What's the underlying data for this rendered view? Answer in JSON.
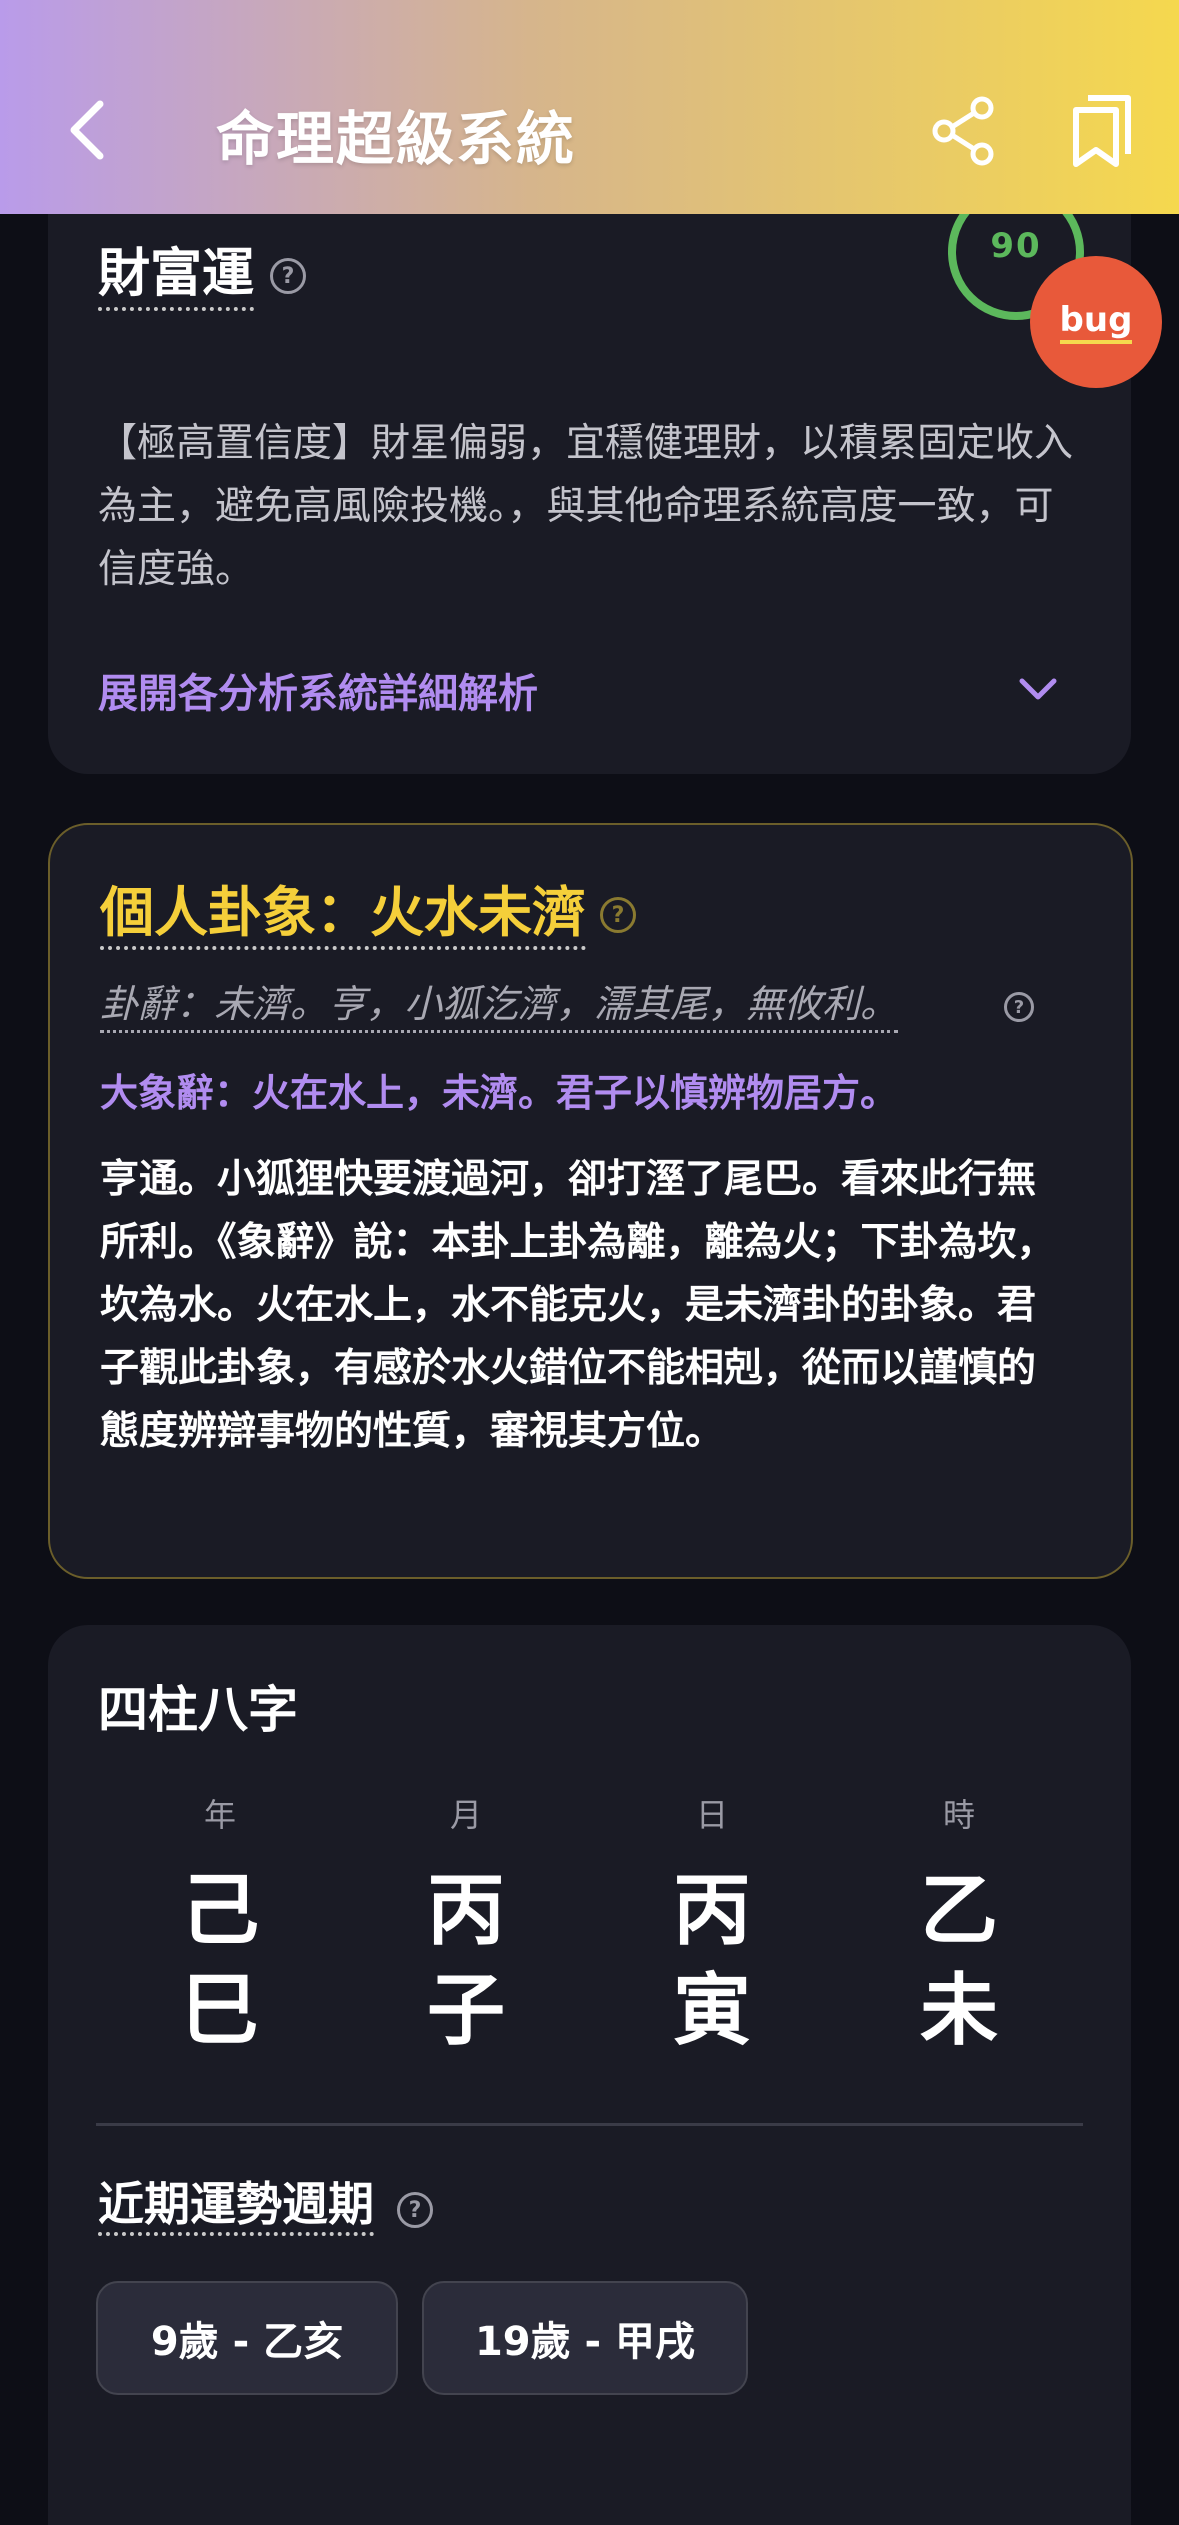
{
  "header": {
    "title": "命理超級系統",
    "back_icon": "chevron-left-icon",
    "share_icon": "share-icon",
    "bookmark_icon": "bookmark-icon",
    "gradient_start": "#b99bea",
    "gradient_end": "#f5d84e"
  },
  "wealth": {
    "title": "財富運",
    "score": "90",
    "score_progress": 0.9,
    "score_color": "#5cb85c",
    "body": "【極高置信度】財星偏弱，宜穩健理財，以積累固定收入為主，避免高風險投機。，與其他命理系統高度一致，可信度強。",
    "expand_label": "展開各分析系統詳細解析"
  },
  "bug_button": {
    "label": "bug",
    "color": "#e8593a"
  },
  "hexagram": {
    "title": "個人卦象：火水未濟",
    "judgment": "卦辭：未濟。亨，小狐汔濟，濡其尾，無攸利。",
    "image_text": "大象辭：火在水上，未濟。君子以慎辨物居方。",
    "body": "亨通。小狐狸快要渡過河，卻打溼了尾巴。看來此行無所利。《象辭》說：本卦上卦為離，離為火；下卦為坎，坎為水。火在水上，水不能克火，是未濟卦的卦象。君子觀此卦象，有感於水火錯位不能相剋，從而以謹慎的態度辨辯事物的性質，審視其方位。",
    "accent_color": "#f5cf3a"
  },
  "pillars": {
    "title": "四柱八字",
    "columns": [
      {
        "label": "年",
        "stem": "己",
        "branch": "巳"
      },
      {
        "label": "月",
        "stem": "丙",
        "branch": "子"
      },
      {
        "label": "日",
        "stem": "丙",
        "branch": "寅"
      },
      {
        "label": "時",
        "stem": "乙",
        "branch": "未"
      }
    ]
  },
  "cycles": {
    "title": "近期運勢週期",
    "chips": [
      "9歲 - 乙亥",
      "19歲 - 甲戌"
    ]
  },
  "help_symbol": "?"
}
